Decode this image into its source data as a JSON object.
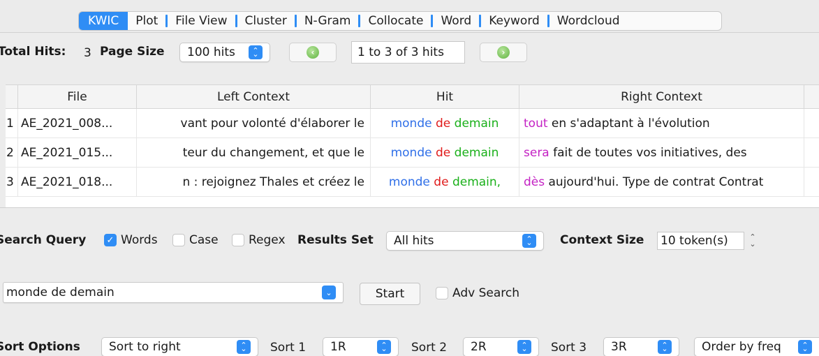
{
  "tabs": [
    "KWIC",
    "Plot",
    "File View",
    "Cluster",
    "N-Gram",
    "Collocate",
    "Word",
    "Keyword",
    "Wordcloud"
  ],
  "active_tab": "KWIC",
  "controls": {
    "total_hits_label": "Total Hits:",
    "total_hits_value": "3",
    "page_size_label": "Page Size",
    "page_size_value": "100 hits",
    "range_text": "1 to 3 of 3 hits"
  },
  "table": {
    "columns": [
      "File",
      "Left Context",
      "Hit",
      "Right Context"
    ],
    "rows": [
      {
        "idx": "1",
        "file": "AE_2021_008...",
        "left": "vant pour volonté d'élaborer le",
        "hit": [
          "monde",
          "de",
          "demain"
        ],
        "right_first": "tout",
        "right_rest": "en s'adaptant à l'évolution"
      },
      {
        "idx": "2",
        "file": "AE_2021_015...",
        "left": "teur du changement, et que le",
        "hit": [
          "monde",
          "de",
          "demain"
        ],
        "right_first": "sera",
        "right_rest": "fait de toutes vos initiatives, des"
      },
      {
        "idx": "3",
        "file": "AE_2021_018...",
        "left": "n : rejoignez Thales et créez le",
        "hit": [
          "monde",
          "de",
          "demain,"
        ],
        "right_first": "dès",
        "right_rest": "aujourd'hui. Type de contrat Contrat"
      }
    ]
  },
  "search": {
    "query_label": "Search Query",
    "words_label": "Words",
    "words_checked": true,
    "case_label": "Case",
    "case_checked": false,
    "regex_label": "Regex",
    "regex_checked": false,
    "results_set_label": "Results Set",
    "results_set_value": "All hits",
    "context_size_label": "Context Size",
    "context_size_value": "10 token(s)",
    "query_value": "monde de demain",
    "start_label": "Start",
    "adv_search_label": "Adv Search",
    "adv_search_checked": false
  },
  "sort": {
    "label": "Sort Options",
    "mode": "Sort to right",
    "sort1_label": "Sort 1",
    "sort1_value": "1R",
    "sort2_label": "Sort 2",
    "sort2_value": "2R",
    "sort3_label": "Sort 3",
    "sort3_value": "3R",
    "order_value": "Order by freq"
  },
  "colors": {
    "accent": "#2f8df5",
    "hit_word1": "#2f6fe8",
    "hit_word2": "#e01b1b",
    "hit_word3": "#1ab01a",
    "right_first": "#c423c4"
  }
}
